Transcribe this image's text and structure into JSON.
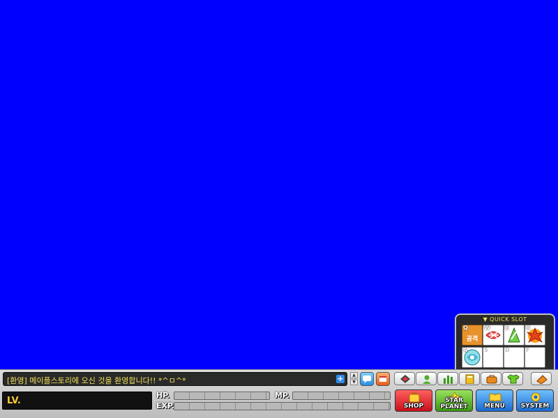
{
  "quick_slot": {
    "title": "▼ QUICK SLOT",
    "slots": [
      {
        "key": "Q",
        "label": "공격",
        "icon": "attack-icon"
      },
      {
        "key": "W",
        "icon": "red-skill-icon"
      },
      {
        "key": "E",
        "icon": "green-skill-icon"
      },
      {
        "key": "R",
        "icon": "fire-skill-icon"
      },
      {
        "key": "A",
        "icon": "cyan-skill-icon"
      },
      {
        "key": "S"
      },
      {
        "key": "D"
      },
      {
        "key": "F"
      }
    ]
  },
  "chat": {
    "message": "[환영] 메이플스토리에 오신 것을 환영합니다!! *^ㅁ^*",
    "plus": "+",
    "scroll_up": "▲",
    "scroll_down": "▼"
  },
  "status": {
    "level_label": "LV.",
    "hp_label": "HP.",
    "mp_label": "MP.",
    "exp_label": "EXP."
  },
  "buttons": {
    "shop": "SHOP",
    "star_planet_line1": "STAR",
    "star_planet_line2": "PLANET",
    "menu": "MENU",
    "system": "SYSTEM"
  },
  "colors": {
    "background": "#0000ff",
    "chat_text": "#f2e25a",
    "shop": "#e0202a",
    "star_planet": "#52b82a",
    "menu": "#2a7fd8",
    "system": "#2a7fd8"
  }
}
